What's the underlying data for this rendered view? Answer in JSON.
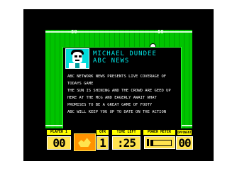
{
  "pitch": {
    "yard_marker": "—50—"
  },
  "reporter": {
    "name": "MICHAEL DUNDEE",
    "station": "ABC NEWS"
  },
  "news": {
    "lines": [
      "ABC NETWORK NEWS PRESENTS LIVE COVERAGE OF",
      "TODAYS GAME",
      "THE SUN IS SHINING AND THE CROWD ARE GEED UP",
      "HERE AT THE MCG AND EAGERLY AWAIT WHAT",
      "PROMISES TO BE A GREAT GAME OF FOOTY",
      "ABC WILL KEEP YOU UP TO DATE ON THE ACTION"
    ]
  },
  "status": {
    "player1_label": "PLAYER 1",
    "player1_score": "00",
    "qtr_label": "QTR",
    "qtr_value": "1",
    "time_left_label": "TIME LEFT",
    "time_left_value": ":25",
    "power_meter_label": "POWER METER",
    "power_level": 0.12,
    "opponent_label": "OPPONENT",
    "opponent_score": "00"
  },
  "colors": {
    "pitch": "#00c400",
    "panel_border": "#2cff2c",
    "headline": "#00e8e8",
    "status_yellow": "#ffe34f"
  }
}
